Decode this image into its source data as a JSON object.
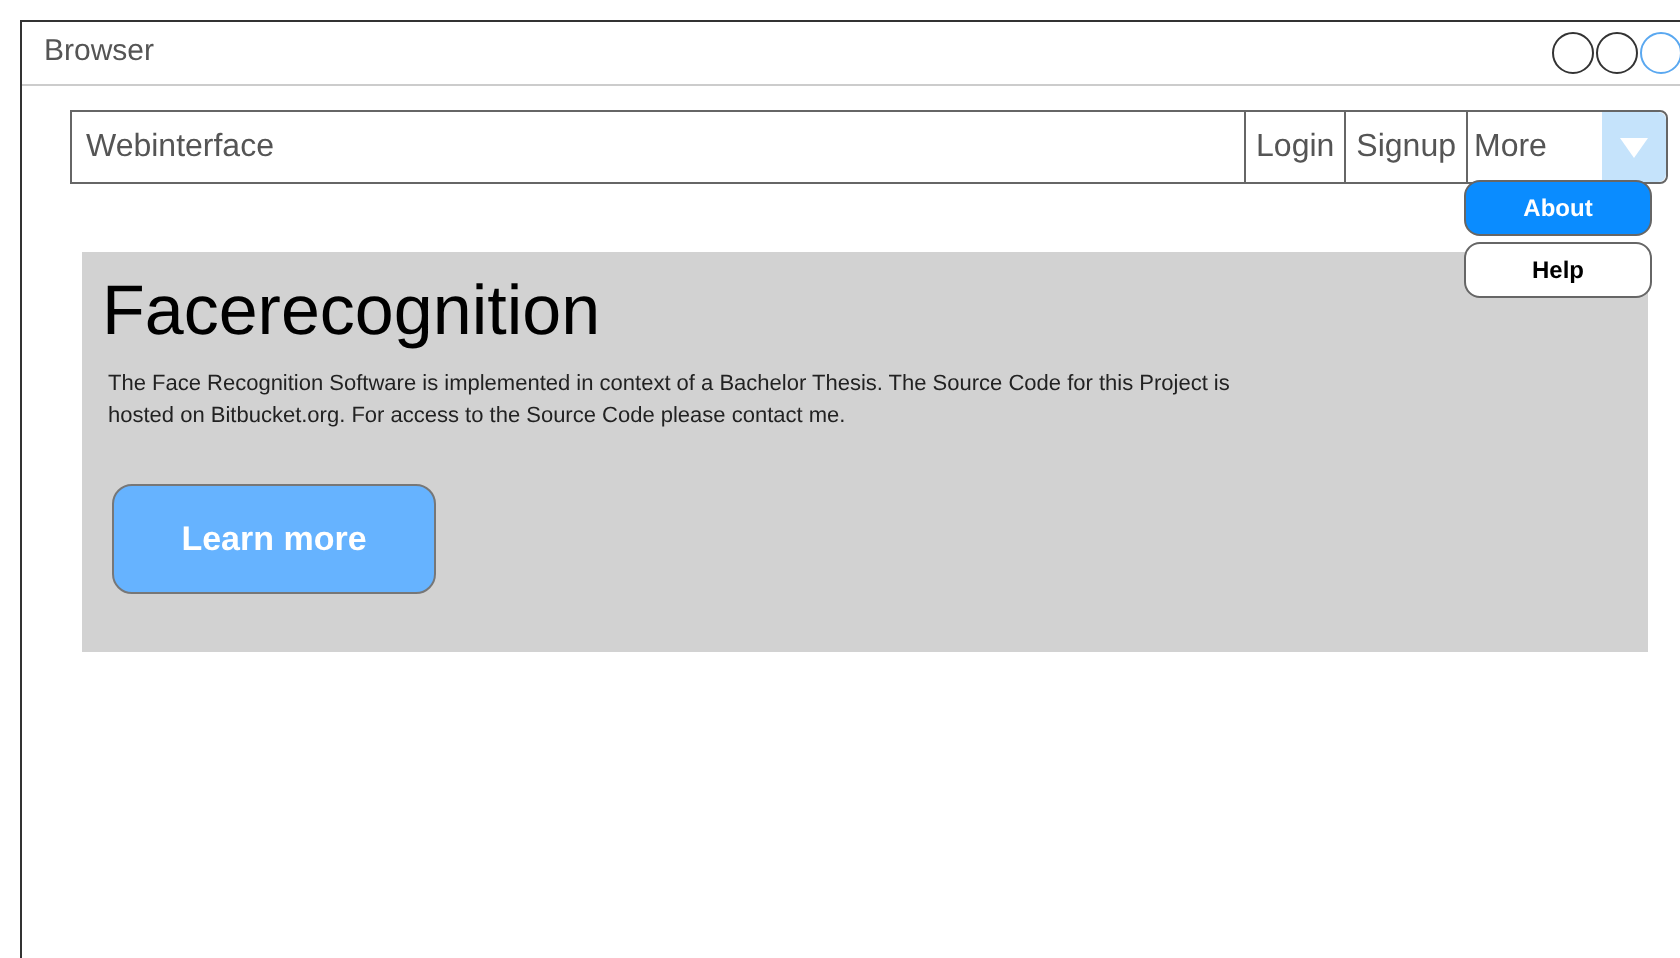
{
  "window": {
    "title": "Browser"
  },
  "navbar": {
    "brand": "Webinterface",
    "links": [
      "Login",
      "Signup"
    ],
    "dropdown": {
      "label": "More",
      "expanded": true,
      "items": [
        {
          "label": "About",
          "selected": true
        },
        {
          "label": "Help",
          "selected": false
        }
      ]
    }
  },
  "hero": {
    "heading": "Facerecognition",
    "text": "The Face Recognition Software is implemented in context of a Bachelor Thesis. The Source Code for this Project is hosted on Bitbucket.org. For access to the Source Code please contact me.",
    "button": "Learn more"
  }
}
